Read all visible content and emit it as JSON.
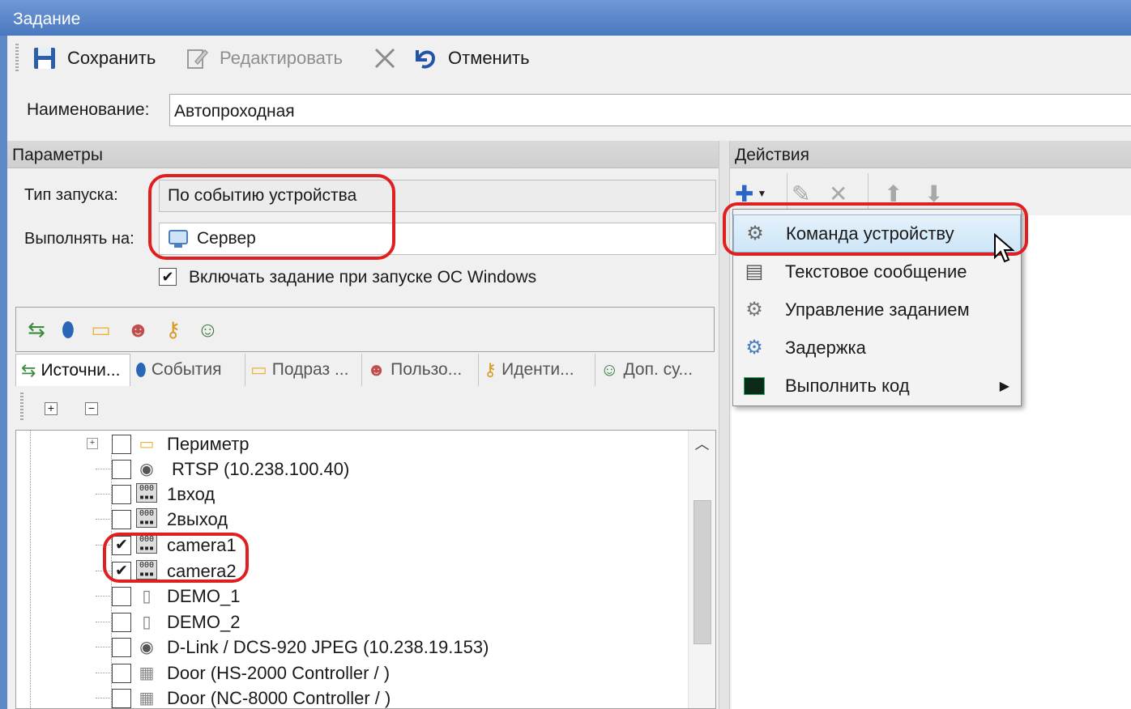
{
  "window": {
    "title": "Задание"
  },
  "toolbar": {
    "save_label": "Сохранить",
    "edit_label": "Редактировать",
    "cancel_label": "Отменить",
    "icons": [
      "save-icon",
      "edit-icon",
      "delete-icon",
      "undo-icon"
    ]
  },
  "name_field": {
    "label": "Наименование:",
    "value": "Автопроходная"
  },
  "params": {
    "header": "Параметры",
    "launch_type_label": "Тип запуска:",
    "launch_type_value": "По событию устройства",
    "run_on_label": "Выполнять на:",
    "run_on_value": "Сервер",
    "autostart_label": "Включать задание при запуске ОС Windows",
    "autostart_checked": true
  },
  "source_tabs": [
    {
      "label": "Источни...",
      "icon": "source-icon",
      "active": true
    },
    {
      "label": "События",
      "icon": "event-icon",
      "active": false
    },
    {
      "label": "Подраз ...",
      "icon": "folder-icon",
      "active": false
    },
    {
      "label": "Пользо...",
      "icon": "users-icon",
      "active": false
    },
    {
      "label": "Иденти...",
      "icon": "key-icon",
      "active": false
    },
    {
      "label": "Доп. су...",
      "icon": "extra-users-icon",
      "active": false
    }
  ],
  "tree": {
    "items": [
      {
        "label": "Периметр",
        "checked": false,
        "icon": "folder-icon",
        "expandable": true
      },
      {
        "label": "RTSP (10.238.100.40)",
        "checked": false,
        "icon": "camera-icon"
      },
      {
        "label": "1вход",
        "checked": false,
        "icon": "dvr-icon"
      },
      {
        "label": "2выход",
        "checked": false,
        "icon": "dvr-icon"
      },
      {
        "label": "camera1",
        "checked": true,
        "icon": "dvr-icon"
      },
      {
        "label": "camera2",
        "checked": true,
        "icon": "dvr-icon"
      },
      {
        "label": "DEMO_1",
        "checked": false,
        "icon": "door-icon"
      },
      {
        "label": "DEMO_2",
        "checked": false,
        "icon": "door-icon"
      },
      {
        "label": "D-Link / DCS-920 JPEG (10.238.19.153)",
        "checked": false,
        "icon": "camera-icon"
      },
      {
        "label": "Door (HS-2000 Controller / )",
        "checked": false,
        "icon": "controller-icon"
      },
      {
        "label": "Door (NC-8000 Controller / )",
        "checked": false,
        "icon": "controller-icon"
      }
    ]
  },
  "actions": {
    "header": "Действия",
    "menu": [
      {
        "label": "Команда устройству",
        "icon": "device-command-icon",
        "highlighted": true
      },
      {
        "label": "Текстовое сообщение",
        "icon": "text-message-icon",
        "highlighted": false
      },
      {
        "label": "Управление заданием",
        "icon": "task-control-icon",
        "highlighted": false
      },
      {
        "label": "Задержка",
        "icon": "delay-icon",
        "highlighted": false
      },
      {
        "label": "Выполнить код",
        "icon": "run-code-icon",
        "highlighted": false,
        "submenu": true
      }
    ]
  },
  "colors": {
    "title_bar": "#4a78c0",
    "highlight_outline": "#e02020",
    "menu_highlight": "#cde6f7"
  }
}
